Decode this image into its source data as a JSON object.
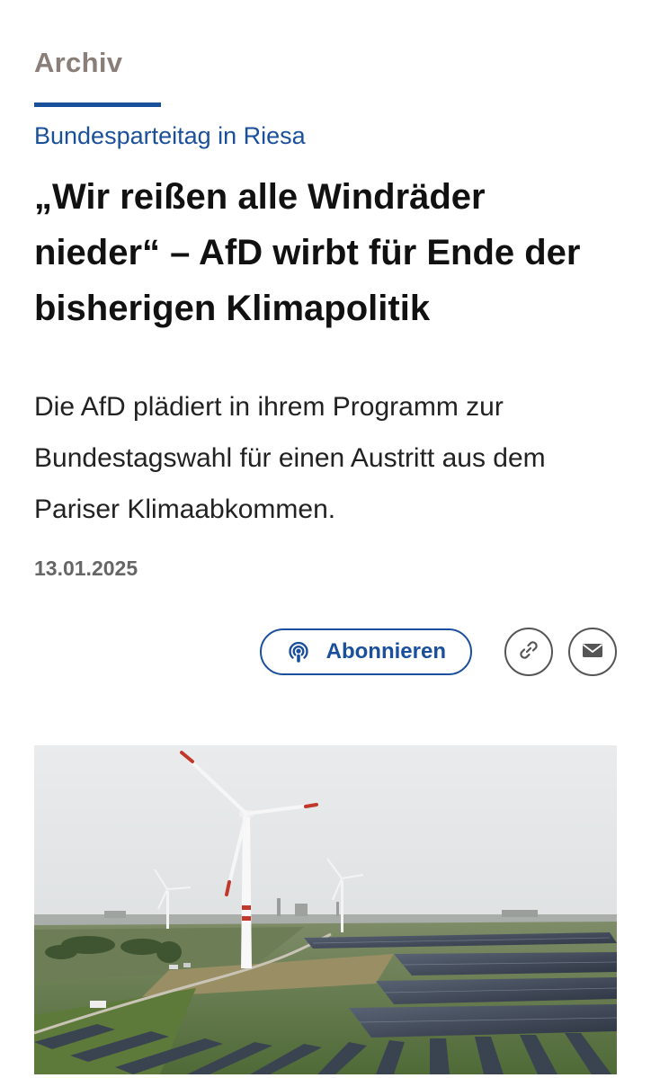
{
  "section": {
    "label": "Archiv"
  },
  "article": {
    "kicker": "Bundesparteitag in Riesa",
    "headline": "„Wir reißen alle Windräder nieder“ – AfD wirbt für Ende der bisherigen Klimapolitik",
    "teaser": "Die AfD plädiert in ihrem Programm zur Bundestagswahl für einen Austritt aus dem Pariser Klimaabkommen.",
    "date": "13.01.2025"
  },
  "actions": {
    "subscribe_label": "Abonnieren",
    "subscribe_icon": "podcast-icon",
    "link_icon": "link-icon",
    "mail_icon": "mail-icon"
  },
  "colors": {
    "accent": "#1a4f9c",
    "section_label": "#8a7f78",
    "date": "#666666"
  }
}
